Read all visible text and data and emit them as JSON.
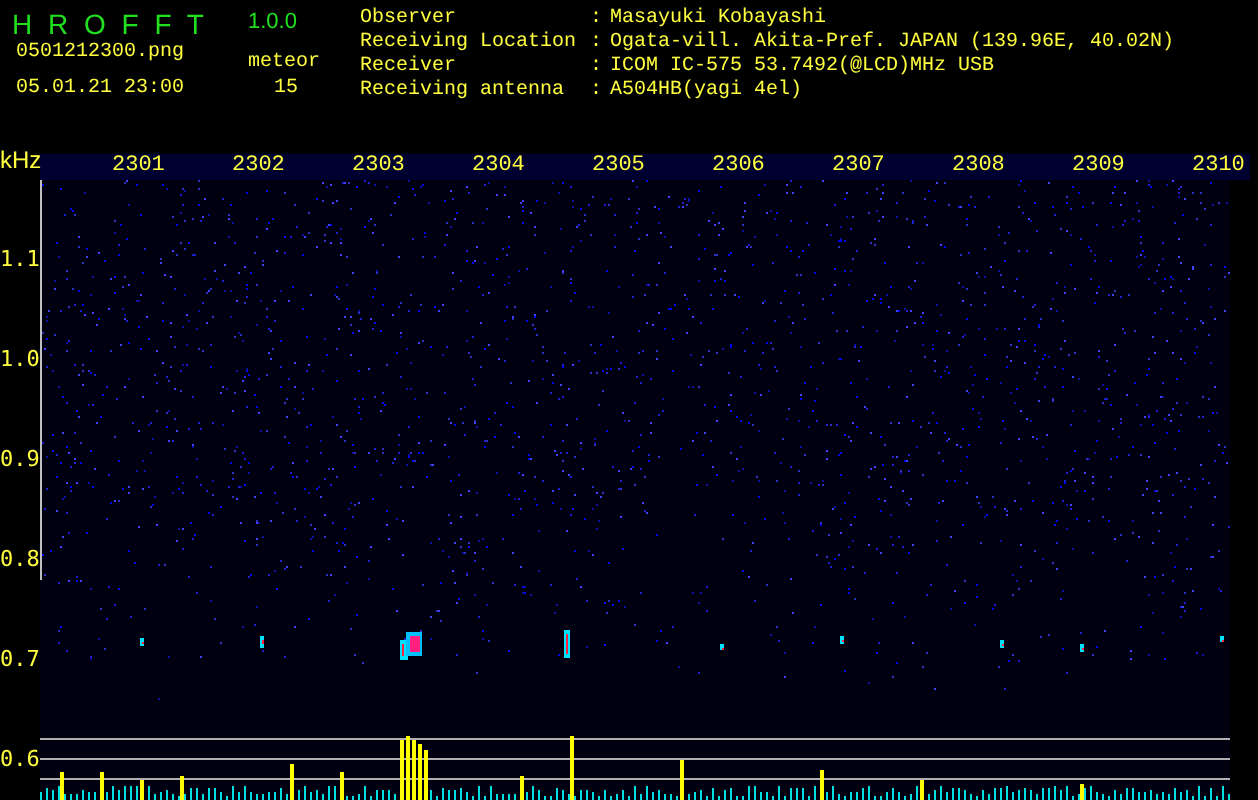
{
  "app": {
    "name": "H R O F F T",
    "version": "1.0.0",
    "file": "0501212300.png",
    "datetime": "05.01.21 23:00",
    "count_label": "meteor",
    "count": "15"
  },
  "info": [
    {
      "label": "Observer",
      "separator": ":",
      "value": "Masayuki Kobayashi"
    },
    {
      "label": "Receiving Location",
      "separator": ":",
      "value": "Ogata-vill. Akita-Pref. JAPAN (139.96E, 40.02N)"
    },
    {
      "label": "Receiver",
      "separator": ":",
      "value": "ICOM IC-575 53.7492(@LCD)MHz USB"
    },
    {
      "label": "Receiving antenna",
      "separator": ":",
      "value": "A504HB(yagi 4el)"
    }
  ],
  "axis": {
    "unit": "kHz",
    "time_labels": [
      "2301",
      "2302",
      "2303",
      "2304",
      "2305",
      "2306",
      "2307",
      "2308",
      "2309",
      "2310"
    ],
    "freq_labels": [
      "1.1",
      "1.0",
      "0.9",
      "0.8",
      "0.7",
      "0.6"
    ]
  }
}
